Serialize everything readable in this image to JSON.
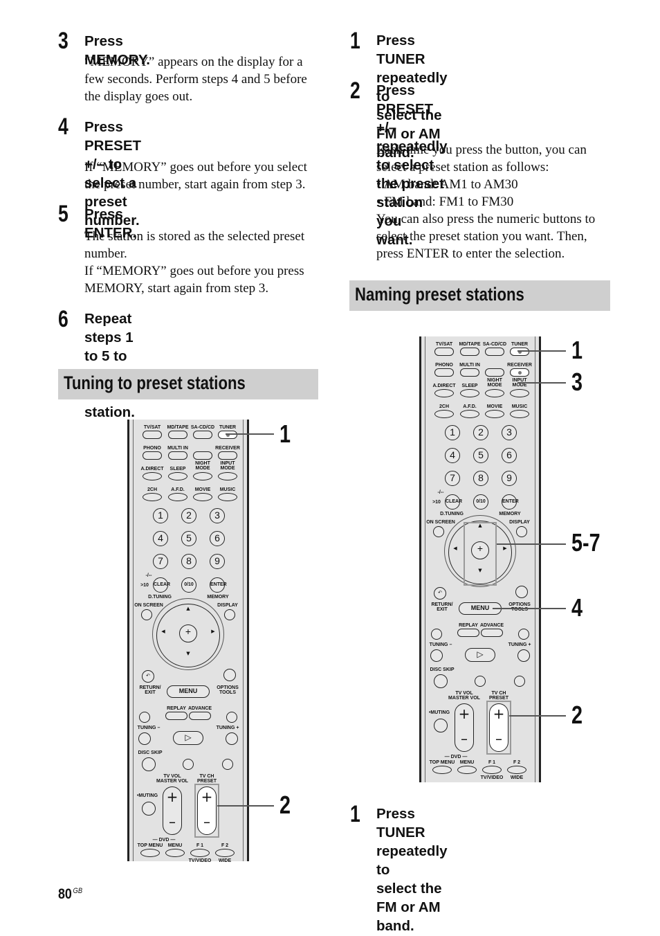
{
  "left_column": {
    "steps": [
      {
        "number": "3",
        "title": "Press MEMORY.",
        "body": [
          "“MEMORY” appears on the display for a",
          "few seconds. Perform steps 4 and 5 before",
          "the display goes out."
        ]
      },
      {
        "number": "4",
        "title_lines": [
          "Press PRESET +/– to select a",
          "preset number."
        ],
        "body": [
          "If “MEMORY” goes out before you select",
          "the preset number, start again from step 3."
        ]
      },
      {
        "number": "5",
        "title": "Press ENTER.",
        "body": [
          "The station is stored as the selected preset",
          "number.",
          "If “MEMORY” goes out before you press",
          "MEMORY, start again from step 3."
        ]
      },
      {
        "number": "6",
        "title_lines": [
          "Repeat steps 1 to 5 to preset",
          "another station."
        ]
      }
    ],
    "section_title": "Tuning to preset stations",
    "callouts": [
      "1",
      "2"
    ]
  },
  "right_column": {
    "steps": [
      {
        "number": "1",
        "title_lines": [
          "Press TUNER repeatedly to",
          "select the FM or AM band."
        ]
      },
      {
        "number": "2",
        "title_lines": [
          "Press PRESET +/– repeatedly",
          "to select the preset station you",
          "want."
        ],
        "body": [
          "Each time you press the button, you can",
          "select a preset station as follows:",
          "• AM band: AM1 to AM30",
          "• FM band: FM1 to FM30",
          "You can also press the numeric buttons to",
          "select the preset station you want. Then,",
          "press ENTER to enter the selection."
        ]
      }
    ],
    "section_title": "Naming preset stations",
    "callouts": [
      "1",
      "3",
      "5-7",
      "4",
      "2"
    ],
    "after_steps": [
      {
        "number": "1",
        "title_lines": [
          "Press TUNER repeatedly to",
          "select the FM or AM band."
        ]
      }
    ]
  },
  "remote": {
    "row1": [
      "TV/SAT",
      "MD/TAPE",
      "SA-CD/CD",
      "TUNER"
    ],
    "row2": [
      "PHONO",
      "MULTI IN",
      "",
      "RECEIVER"
    ],
    "row3": [
      "A.DIRECT",
      "SLEEP",
      "NIGHT\nMODE",
      "INPUT\nMODE"
    ],
    "row4": [
      "2CH",
      "A.F.D.",
      "MOVIE",
      "MUSIC"
    ],
    "numbers": [
      "1",
      "2",
      "3",
      "4",
      "5",
      "6",
      "7",
      "8",
      "9"
    ],
    "clear": "CLEAR",
    "zero": "0/10",
    "enter": "ENTER",
    "gt10": ">10",
    "dash": "-/--",
    "d_tuning": "D.TUNING",
    "memory": "MEMORY",
    "on_screen": "ON SCREEN",
    "display": "DISPLAY",
    "return_exit": "RETURN/\nEXIT",
    "menu": "MENU",
    "options_tools": "OPTIONS\nTOOLS",
    "replay": "REPLAY",
    "advance": "ADVANCE",
    "tuning_minus": "TUNING –",
    "tuning_plus": "TUNING +",
    "disc_skip": "DISC SKIP",
    "tv_vol": "TV VOL\nMASTER VOL",
    "tv_ch": "TV CH\nPRESET",
    "muting": "•MUTING",
    "dvd": "DVD",
    "top_menu": "TOP MENU",
    "dvd_menu": "MENU",
    "f1": "F 1",
    "f2": "F 2",
    "tv_video": "TV/VIDEO",
    "wide": "WIDE"
  },
  "footer": {
    "page_number": "80",
    "region": "GB"
  }
}
